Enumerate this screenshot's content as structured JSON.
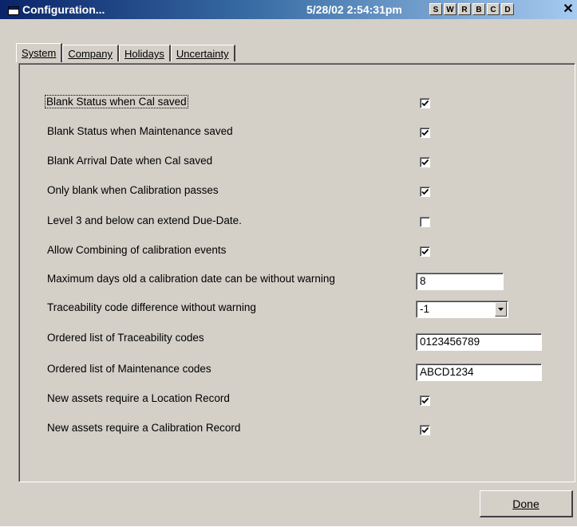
{
  "window": {
    "title": "Configuration...",
    "clock": "5/28/02 2:54:31pm",
    "toolbar_buttons": [
      "S",
      "W",
      "R",
      "B",
      "C",
      "D"
    ],
    "close_glyph": "✕"
  },
  "tabs": [
    {
      "label": "System",
      "active": true
    },
    {
      "label": "Company",
      "active": false
    },
    {
      "label": "Holidays",
      "active": false
    },
    {
      "label": "Uncertainty",
      "active": false
    }
  ],
  "settings": {
    "blank_status_cal": {
      "label": "Blank Status when Cal saved",
      "checked": true
    },
    "blank_status_maint": {
      "label": "Blank Status when Maintenance saved",
      "checked": true
    },
    "blank_arrival_cal": {
      "label": "Blank Arrival Date when Cal saved",
      "checked": true
    },
    "only_blank_pass": {
      "label": "Only blank when Calibration passes",
      "checked": true
    },
    "level3_extend": {
      "label": "Level 3 and below can extend Due-Date.",
      "checked": false
    },
    "allow_combining": {
      "label": "Allow Combining of calibration events",
      "checked": true
    },
    "max_days_old": {
      "label": "Maximum days old a calibration date can be without warning",
      "value": "8"
    },
    "traceability_diff": {
      "label": "Traceability code difference without warning",
      "value": "-1"
    },
    "traceability_codes": {
      "label": "Ordered list of Traceability codes",
      "value": "0123456789"
    },
    "maintenance_codes": {
      "label": "Ordered list of Maintenance codes",
      "value": "ABCD1234"
    },
    "require_location": {
      "label": "New assets require a Location Record",
      "checked": true
    },
    "require_calibration": {
      "label": "New assets require a Calibration Record",
      "checked": true
    }
  },
  "footer": {
    "done_label": "Done"
  },
  "icons": {
    "app": "window-icon",
    "checkmark": "checkmark-icon",
    "dropdown": "chevron-down-icon",
    "close": "close-icon"
  }
}
